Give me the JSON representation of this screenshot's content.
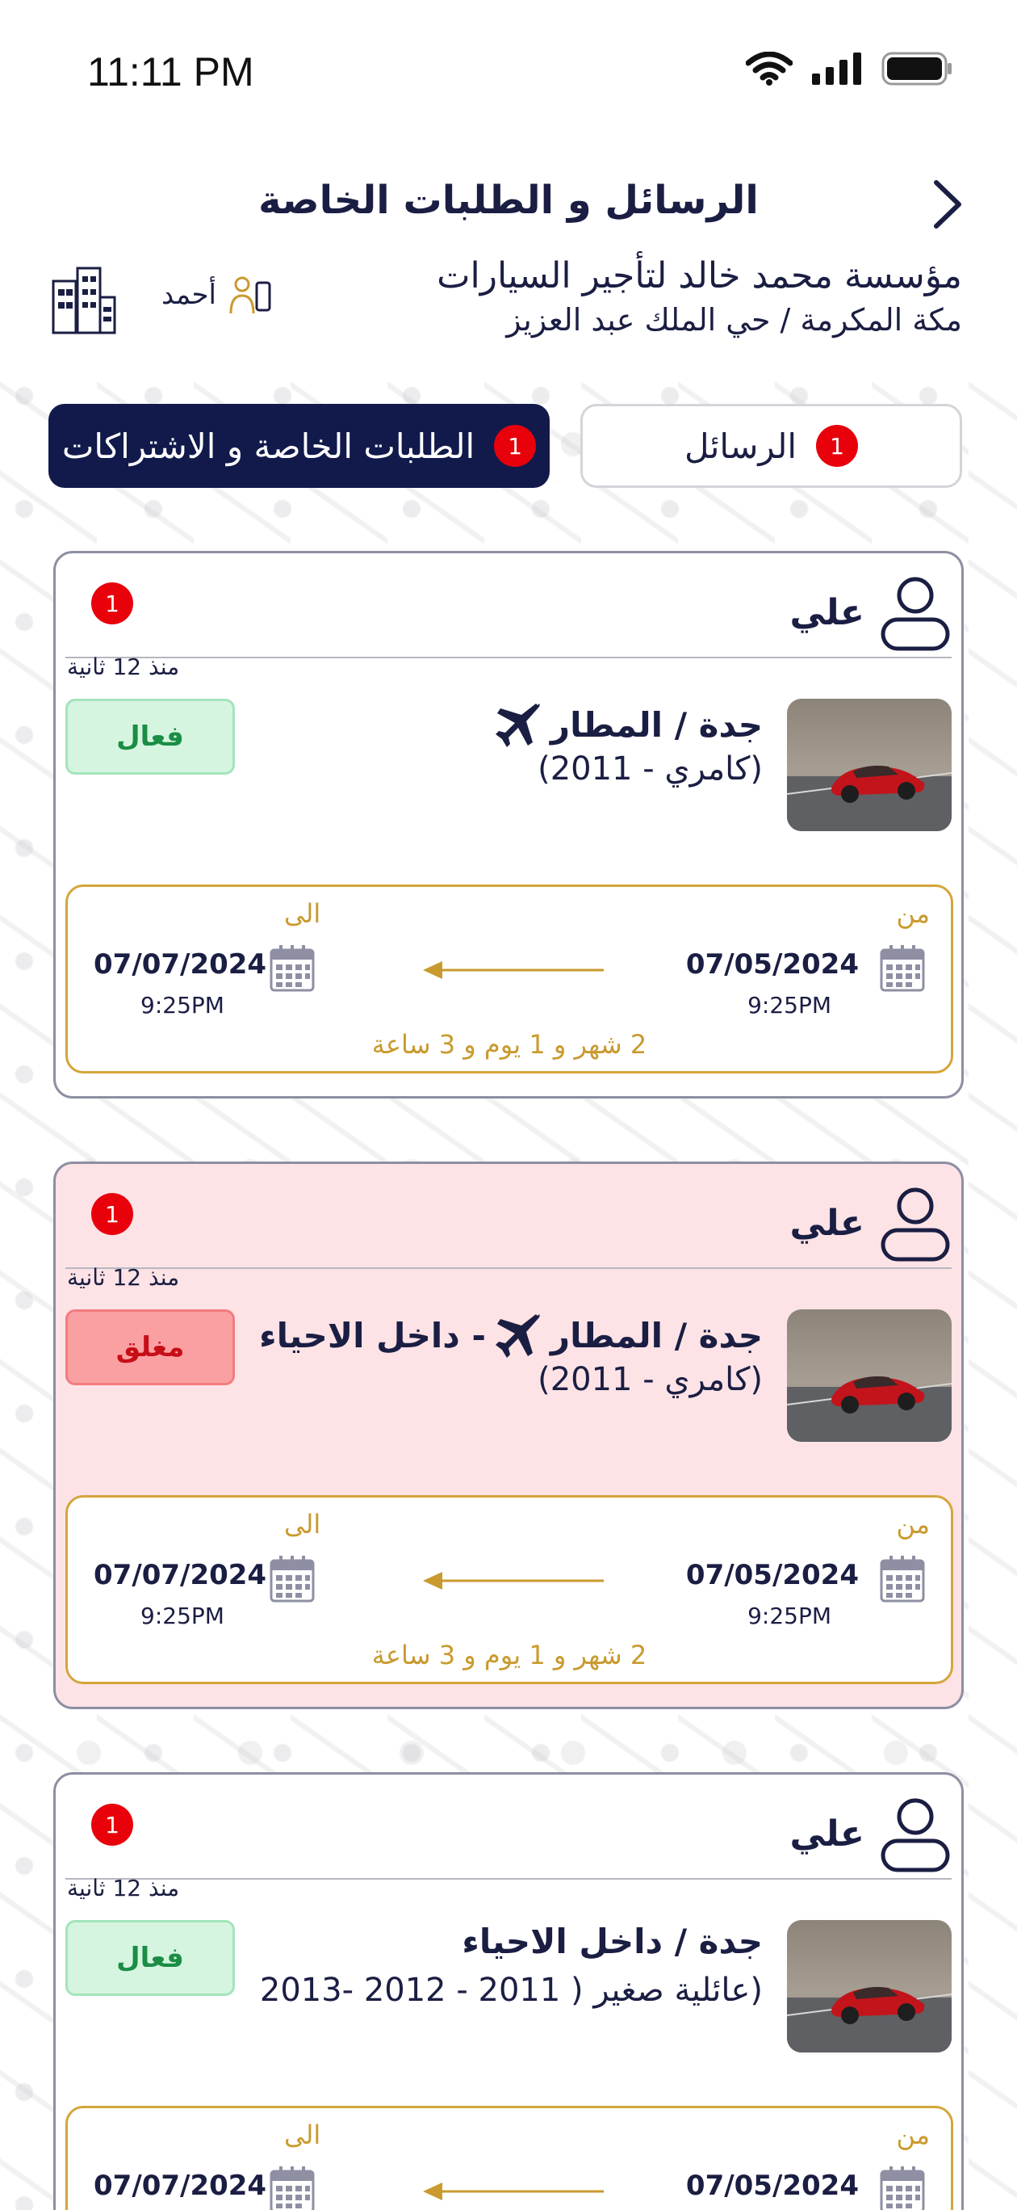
{
  "status_bar": {
    "time": "11:11 PM"
  },
  "header": {
    "title": "الرسائل و الطلبات الخاصة"
  },
  "company": {
    "name": "مؤسسة محمد خالد لتأجير السيارات",
    "address": "مكة المكرمة / حي الملك عبد العزيز",
    "agent_name": "أحمد"
  },
  "tabs": {
    "messages": {
      "label": "الرسائل",
      "badge": "1"
    },
    "requests": {
      "label": "الطلبات الخاصة و الاشتراكات",
      "badge": "1"
    }
  },
  "colors": {
    "navy": "#111a4b",
    "gold": "#c99a2e",
    "active_green": "#1b8d45",
    "closed_red": "#c70e17",
    "badge_red": "#e8000b"
  },
  "requests": [
    {
      "user": "علي",
      "badge": "1",
      "time_ago": "منذ 12 ثانية",
      "route_prefix": "جدة / المطار",
      "route_suffix": "",
      "model": "(كامري - 2011)",
      "status": "فعال",
      "from_label": "من",
      "to_label": "الى",
      "from_date": "07/05/2024",
      "from_time": "9:25PM",
      "to_date": "07/07/2024",
      "to_time": "9:25PM",
      "duration": "2 شهر و 1 يوم و 3 ساعة"
    },
    {
      "user": "علي",
      "badge": "1",
      "time_ago": "منذ 12 ثانية",
      "route_prefix": "جدة / المطار",
      "route_suffix": "- داخل الاحياء",
      "model": "(كامري - 2011)",
      "status": "مغلق",
      "from_label": "من",
      "to_label": "الى",
      "from_date": "07/05/2024",
      "from_time": "9:25PM",
      "to_date": "07/07/2024",
      "to_time": "9:25PM",
      "duration": "2 شهر و 1 يوم و 3 ساعة"
    },
    {
      "user": "علي",
      "badge": "1",
      "time_ago": "منذ 12 ثانية",
      "route_prefix": "جدة / داخل الاحياء",
      "route_suffix": "",
      "model": "(عائلية صغير ( 2011 - 2012 -2013",
      "status": "فعال",
      "from_label": "من",
      "to_label": "الى",
      "from_date": "07/05/2024",
      "from_time": "",
      "to_date": "07/07/2024",
      "to_time": "",
      "duration": ""
    }
  ]
}
